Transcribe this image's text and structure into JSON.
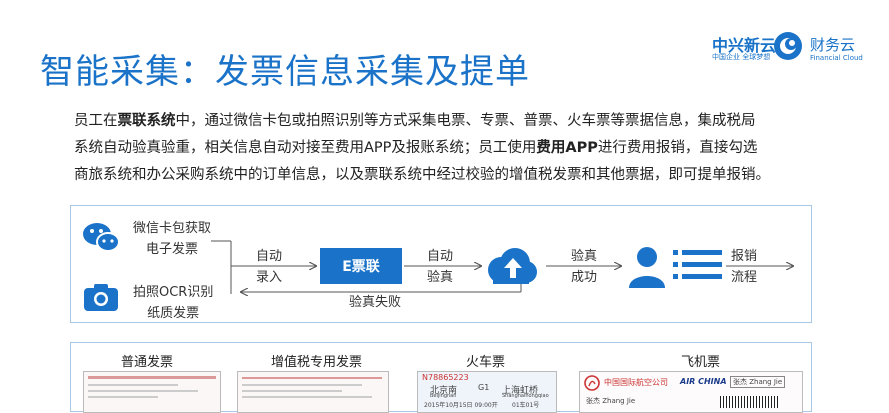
{
  "title": "智能采集：发票信息采集及提单",
  "logo": {
    "brand": "中兴新云",
    "brand_sub": "中国企业 全球梦想",
    "finance": "财务云",
    "finance_sub": "Financial Cloud"
  },
  "paragraph": {
    "p1a": "员工在",
    "p1b": "票联系统",
    "p1c": "中，通过微信卡包或拍照识别等方式采集电票、专票、普票、火车票等票据信息，集成税局",
    "p2a": "系统自动验真验重，相关信息自动对接至费用APP及报账系统；员工使用",
    "p2b": "费用APP",
    "p2c": "进行费用报销，直接勾选",
    "p3": "商旅系统和办公采购系统中的订单信息，以及票联系统中经过校验的增值税发票和其他票据，即可提单报销。"
  },
  "flow": {
    "wechat_l1": "微信卡包获取",
    "wechat_l2": "电子发票",
    "photo_l1": "拍照OCR识别",
    "photo_l2": "纸质发票",
    "auto_entry_l1": "自动",
    "auto_entry_l2": "录入",
    "epiao": "E票联",
    "auto_verify_l1": "自动",
    "auto_verify_l2": "验真",
    "verify_ok_l1": "验真",
    "verify_ok_l2": "成功",
    "verify_fail": "验真失败",
    "reimburse_l1": "报销",
    "reimburse_l2": "流程"
  },
  "invoices": {
    "normal": "普通发票",
    "vat": "增值税专用发票",
    "train": "火车票",
    "flight": "飞机票",
    "train_no": "N78865223",
    "train_from": "北京南",
    "train_to": "上海虹桥",
    "train_code": "G1",
    "train_from_en": "Beijingnan",
    "train_to_en": "Shanghaihongqiao",
    "train_date": "2015年10月15日 09:00开",
    "train_seat": "01车01号",
    "air_cn": "中国国际航空公司",
    "air_en": "AIR CHINA",
    "passenger": "张杰 Zhang Jie"
  },
  "colors": {
    "accent": "#1a73c8",
    "border": "#a9c7e8"
  }
}
